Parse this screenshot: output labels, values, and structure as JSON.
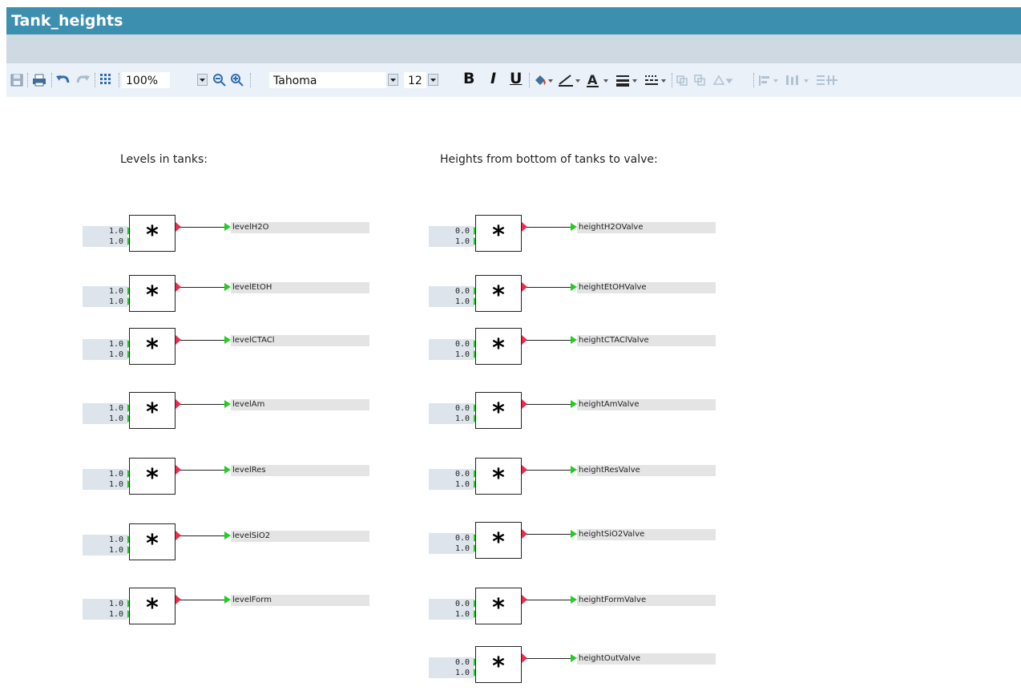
{
  "window": {
    "title": "Tank_heights"
  },
  "toolbar": {
    "zoom": "100%",
    "font_family": "Tahoma",
    "font_size": "12",
    "bold": "B",
    "italic": "I",
    "underline": "U"
  },
  "canvas": {
    "left_heading": "Levels in tanks:",
    "right_heading": "Heights from bottom of tanks to valve:",
    "operator": "*",
    "left_blocks": [
      {
        "in1": "1.0",
        "in2": "1.0",
        "output": "levelH2O"
      },
      {
        "in1": "1.0",
        "in2": "1.0",
        "output": "levelEtOH"
      },
      {
        "in1": "1.0",
        "in2": "1.0",
        "output": "levelCTACl"
      },
      {
        "in1": "1.0",
        "in2": "1.0",
        "output": "levelAm"
      },
      {
        "in1": "1.0",
        "in2": "1.0",
        "output": "levelRes"
      },
      {
        "in1": "1.0",
        "in2": "1.0",
        "output": "levelSiO2"
      },
      {
        "in1": "1.0",
        "in2": "1.0",
        "output": "levelForm"
      }
    ],
    "right_blocks": [
      {
        "in1": "0.0",
        "in2": "1.0",
        "output": "heightH2OValve"
      },
      {
        "in1": "0.0",
        "in2": "1.0",
        "output": "heightEtOHValve"
      },
      {
        "in1": "0.0",
        "in2": "1.0",
        "output": "heightCTAClValve"
      },
      {
        "in1": "0.0",
        "in2": "1.0",
        "output": "heightAmValve"
      },
      {
        "in1": "0.0",
        "in2": "1.0",
        "output": "heightResValve"
      },
      {
        "in1": "0.0",
        "in2": "1.0",
        "output": "heightSiO2Valve"
      },
      {
        "in1": "0.0",
        "in2": "1.0",
        "output": "heightFormValve"
      },
      {
        "in1": "0.0",
        "in2": "1.0",
        "output": "heightOutValve"
      }
    ]
  },
  "colors": {
    "title_bar": "#3d8fb0",
    "input_pin": "#22cc22",
    "output_pin": "#ee2b4a"
  },
  "icons": [
    "save-icon",
    "print-icon",
    "undo-icon",
    "redo-icon",
    "grid-icon",
    "zoom-out-icon",
    "zoom-in-icon",
    "fill-color-icon",
    "line-color-icon",
    "font-color-icon",
    "line-width-icon",
    "line-style-icon"
  ]
}
